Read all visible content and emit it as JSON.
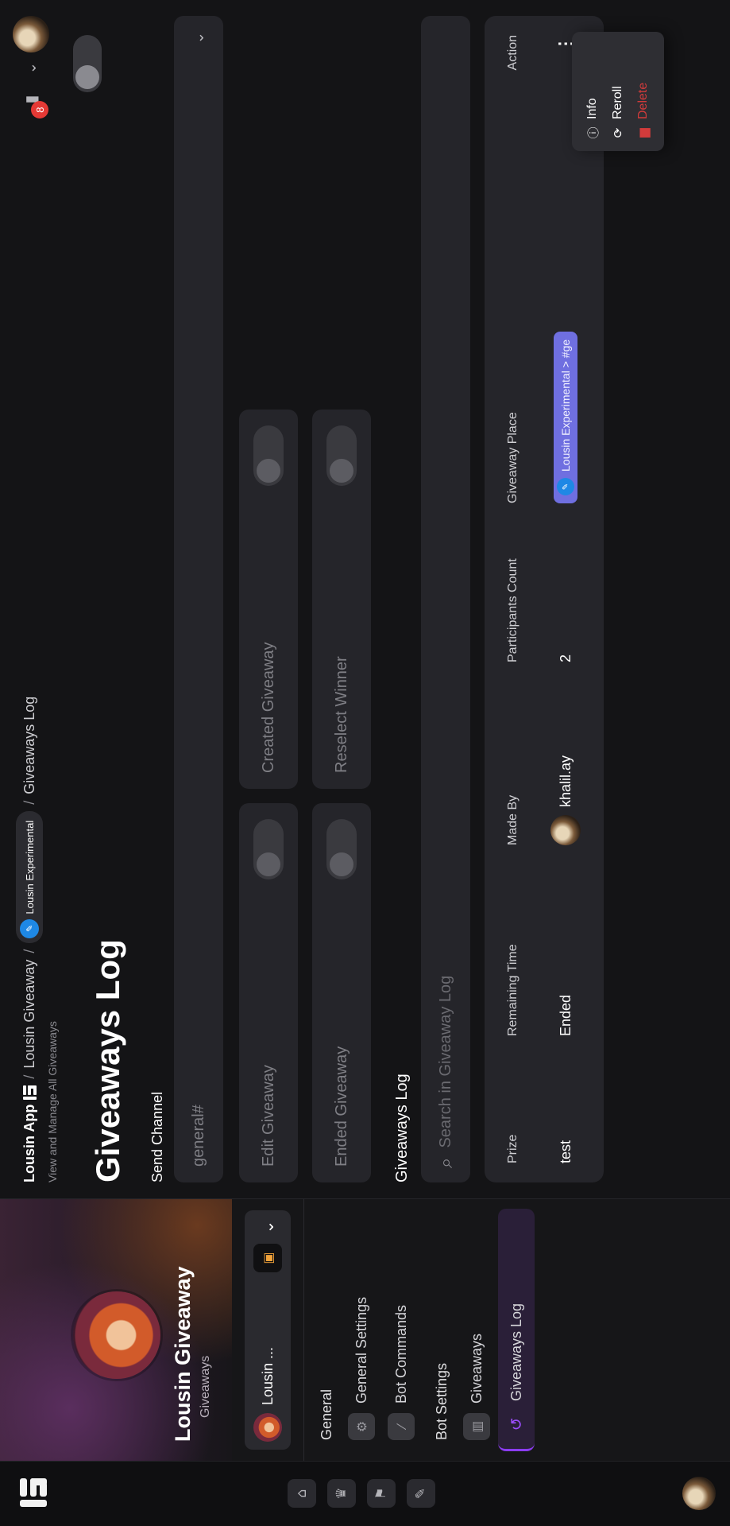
{
  "rail": {
    "icons": [
      "home-icon",
      "crown-icon",
      "flag-icon",
      "wrench-icon"
    ]
  },
  "sidebar": {
    "title": "Lousin Giveaway",
    "subtitle": "Giveaways",
    "server_name": "Lousin ...",
    "sections": [
      {
        "heading": "General",
        "items": [
          {
            "label": "General Settings",
            "icon": "gear-icon"
          },
          {
            "label": "Bot Commands",
            "icon": "slash-icon"
          }
        ]
      },
      {
        "heading": "Bot Settings",
        "items": [
          {
            "label": "Giveaways",
            "icon": "gift-icon"
          },
          {
            "label": "Giveaways Log",
            "icon": "history-icon",
            "active": true
          }
        ]
      }
    ]
  },
  "header": {
    "app_name": "Lousin App",
    "crumb_1": "Lousin Giveaway",
    "server_pill": "Lousin Experimental",
    "crumb_3": "Giveaways Log",
    "subtitle": "View and Manage All Giveaways",
    "notification_count": "8"
  },
  "main": {
    "title": "Giveaways Log",
    "send_channel_label": "Send Channel",
    "send_channel_value": "general#",
    "toggles": [
      {
        "label": "Edit Giveaway"
      },
      {
        "label": "Created Giveaway"
      },
      {
        "label": "Ended Giveaway"
      },
      {
        "label": "Reselect Winner"
      }
    ],
    "log_title": "Giveaways Log",
    "search_placeholder": "Search in Giveaway Log"
  },
  "table": {
    "columns": [
      "Prize",
      "Remaining Time",
      "Made By",
      "Participants Count",
      "Giveaway Place",
      "Action"
    ],
    "rows": [
      {
        "prize": "test",
        "remaining": "Ended",
        "made_by": "khalil.ay",
        "participants": "2",
        "place": "Lousin Experimental > #ge"
      }
    ]
  },
  "action_menu": {
    "items": [
      {
        "label": "Info",
        "icon": "info-icon"
      },
      {
        "label": "Reroll",
        "icon": "reroll-icon"
      },
      {
        "label": "Delete",
        "icon": "trash-icon"
      }
    ]
  },
  "colors": {
    "accent": "#8b3cf0",
    "danger": "#d23b3b",
    "badge": "#e53935",
    "place_pill": "#6f6fe0"
  }
}
